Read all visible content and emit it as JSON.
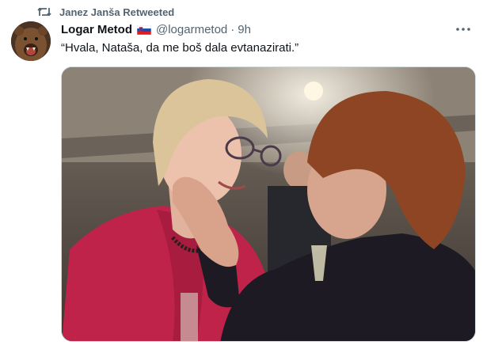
{
  "retweet": {
    "icon": "retweet-icon",
    "text": "Janez Janša Retweeted"
  },
  "tweet": {
    "avatar": "bear-avatar",
    "display_name": "Logar Metod",
    "flag": "slovenia-flag-icon",
    "handle": "@logarmetod",
    "separator": "·",
    "time": "9h",
    "text": "“Hvala, Nataša, da me boš dala evtanazirati.”",
    "more_icon": "more-options-icon",
    "media": "photo-two-women"
  },
  "colors": {
    "secondary_text": "#536471",
    "primary_text": "#0f1419",
    "border": "#cfd9de",
    "jacket": "#c0234a"
  }
}
